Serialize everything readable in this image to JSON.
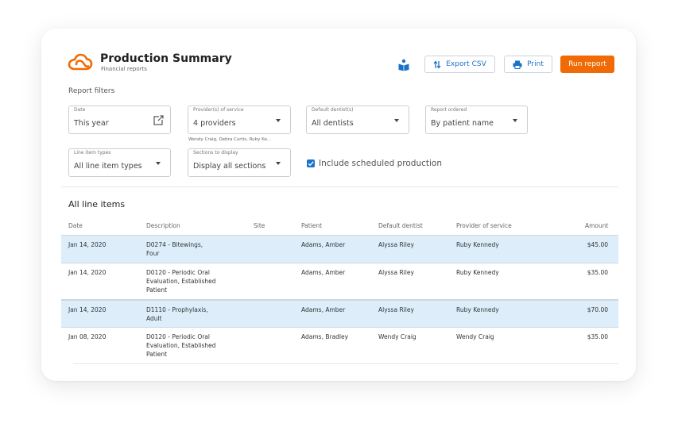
{
  "header": {
    "title": "Production Summary",
    "subtitle": "Financial reports",
    "help_icon": "book-icon",
    "export_label": "Export CSV",
    "export_icon": "sort-arrows-icon",
    "print_label": "Print",
    "print_icon": "printer-icon",
    "run_label": "Run report"
  },
  "filters": {
    "section_label": "Report filters",
    "date": {
      "label": "Date",
      "value": "This year",
      "icon": "external-link-icon"
    },
    "providers": {
      "label": "Provider(s) of service",
      "value": "4 providers",
      "hint": "Wendy Craig, Debra Curtis, Ruby Ke..."
    },
    "default_dentist": {
      "label": "Default dentist(s)",
      "value": "All dentists"
    },
    "report_ordered": {
      "label": "Report ordered",
      "value": "By patient name"
    },
    "line_item_types": {
      "label": "Line item types",
      "value": "All line item types"
    },
    "sections": {
      "label": "Sections to display",
      "value": "Display all sections"
    },
    "include_scheduled": {
      "label": "Include scheduled production",
      "checked": true
    }
  },
  "table": {
    "title": "All line items",
    "columns": [
      "Date",
      "Description",
      "Site",
      "Patient",
      "Default dentist",
      "Provider of service",
      "Amount"
    ],
    "rows": [
      {
        "date": "Jan 14, 2020",
        "description": [
          "D0274 - Bitewings,",
          "Four"
        ],
        "site": "",
        "patient": "Adams, Amber",
        "dentist": "Alyssa Riley",
        "provider": "Ruby Kennedy",
        "amount": "$45.00",
        "highlighted": true
      },
      {
        "date": "Jan 14, 2020",
        "description": [
          "D0120 - Periodic Oral",
          "Evaluation, Established",
          "Patient"
        ],
        "site": "",
        "patient": "Adams, Amber",
        "dentist": "Alyssa Riley",
        "provider": "Ruby Kennedy",
        "amount": "$35.00",
        "highlighted": false
      },
      {
        "date": "Jan 14, 2020",
        "description": [
          "D1110 - Prophylaxis,",
          "Adult"
        ],
        "site": "",
        "patient": "Adams, Amber",
        "dentist": "Alyssa Riley",
        "provider": "Ruby Kennedy",
        "amount": "$70.00",
        "highlighted": true
      },
      {
        "date": "Jan 08, 2020",
        "description": [
          "D0120 - Periodic Oral",
          "Evaluation, Established",
          "Patient"
        ],
        "site": "",
        "patient": "Adams, Bradley",
        "dentist": "Wendy Craig",
        "provider": "Wendy Craig",
        "amount": "$35.00",
        "highlighted": false
      }
    ]
  },
  "colors": {
    "accent": "#f06b06",
    "link": "#1a73c8",
    "row_highlight": "#ddeefa"
  }
}
